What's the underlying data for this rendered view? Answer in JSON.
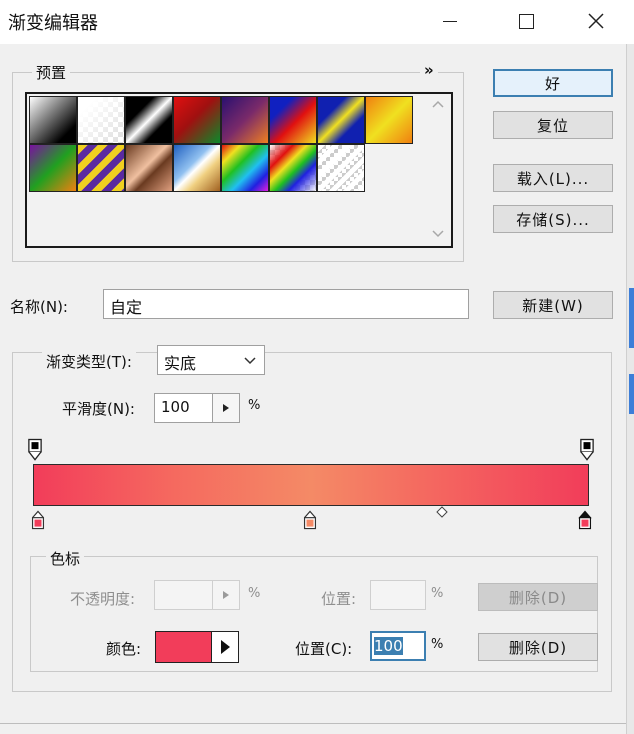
{
  "window": {
    "title": "渐变编辑器"
  },
  "presets": {
    "label": "预置",
    "menu_glyph": "»",
    "swatches": [
      "black-white",
      "transparent-white",
      "black-white-stripe",
      "red-green",
      "violet-orange",
      "blue-red-yellow",
      "blue-yellow-blue",
      "orange-yellow-orange",
      "violet-green-orange",
      "yellow-violet-stripes",
      "copper",
      "chrome",
      "spectrum",
      "transparent-rainbow",
      "transparent-stripes"
    ]
  },
  "buttons": {
    "ok": "好",
    "reset": "复位",
    "load": "载入(L)...",
    "save": "存储(S)...",
    "new": "新建(W)",
    "delete_opacity": "删除(D)",
    "delete_color": "删除(D)"
  },
  "name": {
    "label": "名称(N):",
    "value": "自定"
  },
  "gradient": {
    "type_label": "渐变类型(T):",
    "type_value": "实底",
    "smooth_label": "平滑度(N):",
    "smooth_value": "100",
    "smooth_unit": "%"
  },
  "stops": {
    "section_label": "色标",
    "opacity_label": "不透明度:",
    "opacity_unit": "%",
    "opacity_location_label": "位置:",
    "opacity_location_unit": "%",
    "color_label": "颜色:",
    "color_value": "#f23d5a",
    "location_label": "位置(C):",
    "location_value": "100",
    "location_unit": "%"
  },
  "colors": {
    "gradient_start": "#f23d5a",
    "gradient_mid": "#f48a66",
    "accent": "#3c7fb1"
  }
}
